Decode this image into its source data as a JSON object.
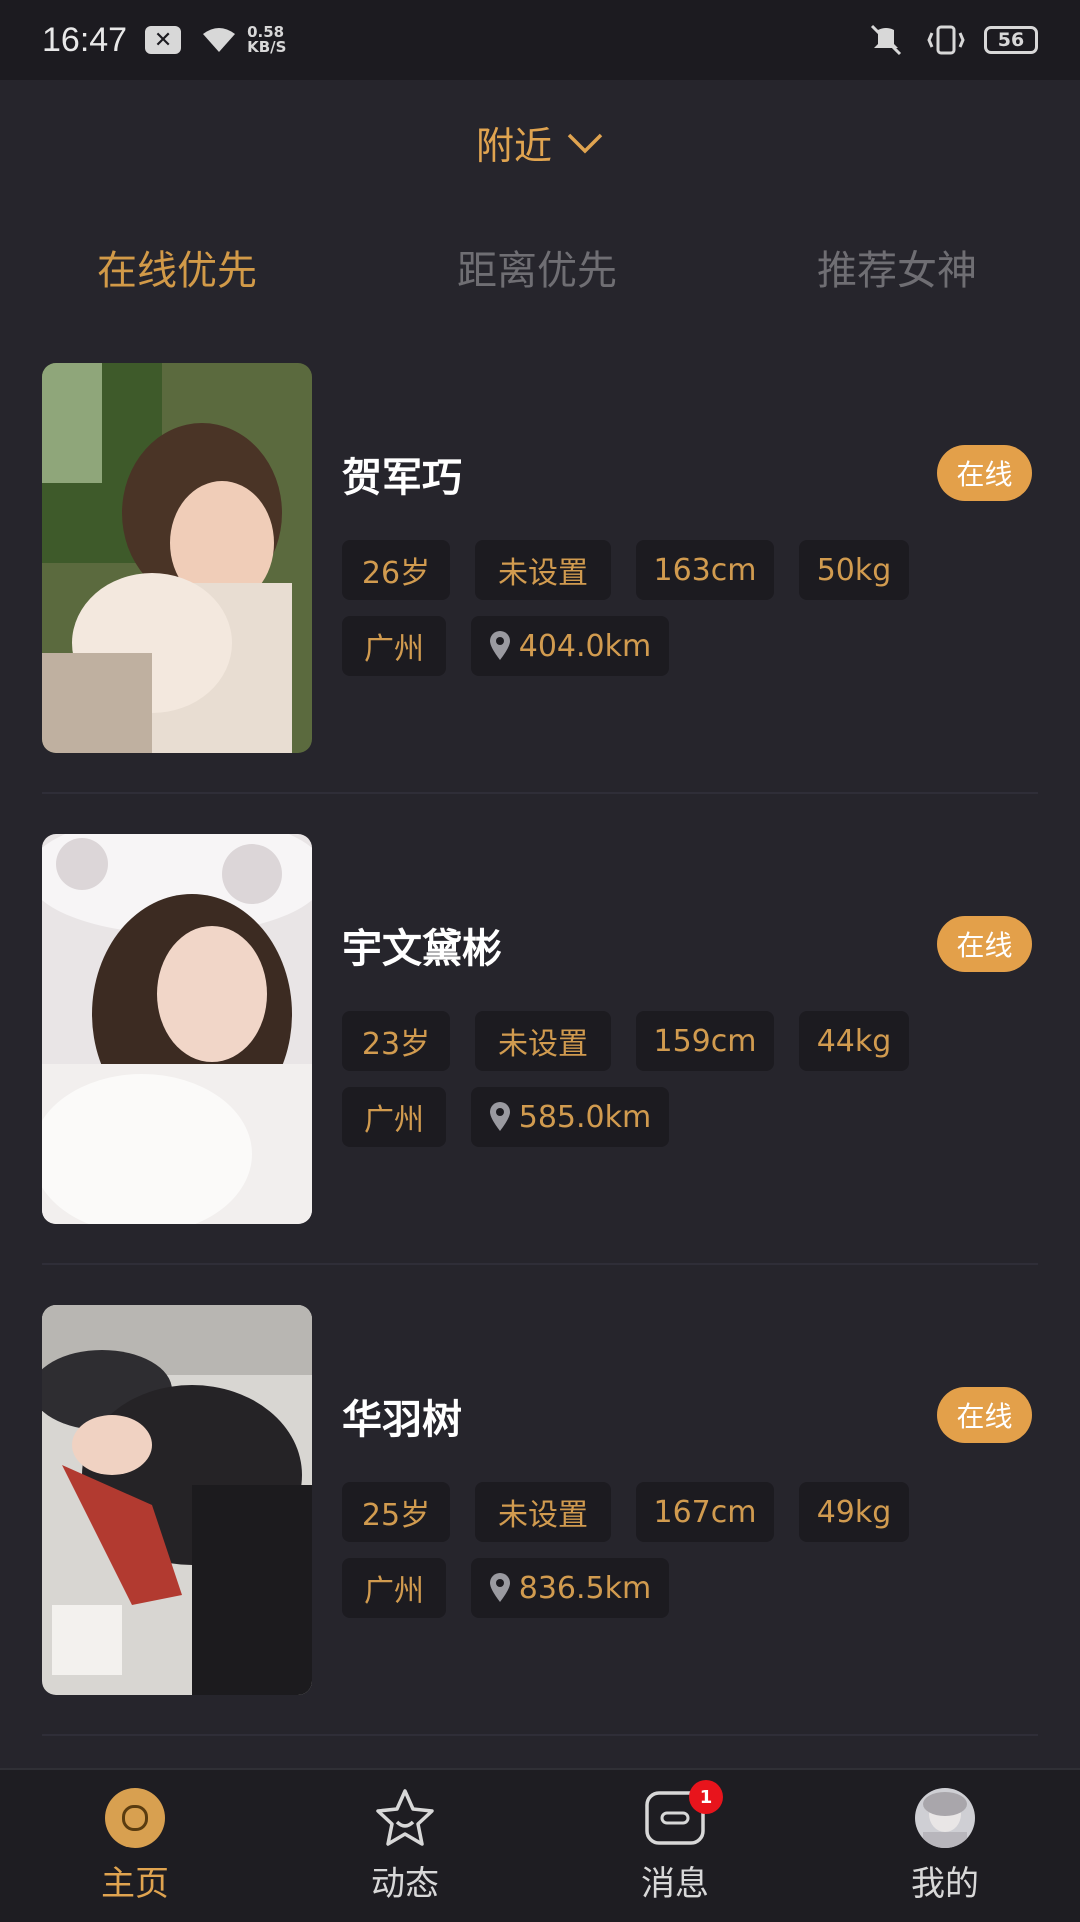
{
  "status": {
    "time": "16:47",
    "net_speed_value": "0.58",
    "net_speed_unit": "KB/S",
    "battery": "56"
  },
  "header": {
    "title": "附近"
  },
  "tabs": [
    "在线优先",
    "距离优先",
    "推荐女神"
  ],
  "users": [
    {
      "name": "贺军巧",
      "status": "在线",
      "age": "26岁",
      "unset": "未设置",
      "height": "163cm",
      "weight": "50kg",
      "city": "广州",
      "distance": "404.0km"
    },
    {
      "name": "宇文黛彬",
      "status": "在线",
      "age": "23岁",
      "unset": "未设置",
      "height": "159cm",
      "weight": "44kg",
      "city": "广州",
      "distance": "585.0km"
    },
    {
      "name": "华羽树",
      "status": "在线",
      "age": "25岁",
      "unset": "未设置",
      "height": "167cm",
      "weight": "49kg",
      "city": "广州",
      "distance": "836.5km"
    }
  ],
  "nav": {
    "home": "主页",
    "moments": "动态",
    "messages": "消息",
    "messages_badge": "1",
    "mine": "我的"
  },
  "colors": {
    "accent": "#e0a450",
    "background": "#26252c",
    "chip_bg": "#1c1b20",
    "online_badge": "#e3a04a",
    "inactive_tab": "#6f6e73"
  }
}
